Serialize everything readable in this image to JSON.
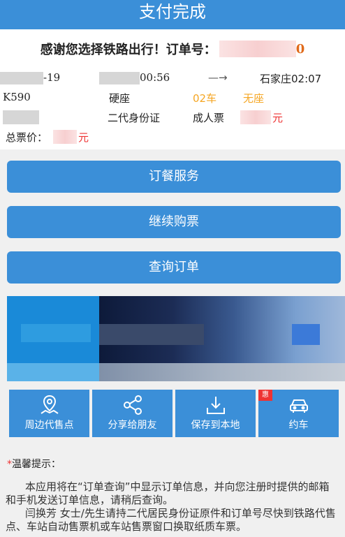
{
  "header": {
    "title": "支付完成"
  },
  "thanks": {
    "text": "感谢您选择铁路出行！订单号：",
    "order_tail": "0"
  },
  "ticket": {
    "date_suffix": "-19",
    "depart_time": "00:56",
    "arrow": "—→",
    "arrive": "石家庄02:07",
    "train_no": "K590",
    "seat_class": "硬座",
    "car": "02车",
    "seat": "无座",
    "id_type": "二代身份证",
    "ticket_type": "成人票",
    "price_unit": "元"
  },
  "total": {
    "label": "总票价：",
    "unit": "元"
  },
  "buttons": {
    "meal": "订餐服务",
    "continue": "继续购票",
    "query": "查询订单"
  },
  "tools": {
    "nearby": "周边代售点",
    "share": "分享给朋友",
    "save": "保存到本地",
    "car": "约车",
    "car_badge": "惠"
  },
  "tips": {
    "title": "温馨提示：",
    "line1": "本应用将在“订单查询”中显示订单信息，并向您注册时提供的邮箱和手机发送订单信息，请稍后查询。",
    "line2": "闫换芳 女士/先生请持二代居民身份证原件和订单号尽快到铁路代售点、车站自动售票机或车站售票窗口换取纸质车票。"
  },
  "colors": {
    "primary": "#3b8fd8",
    "accent": "#f5a623",
    "danger": "#e33333"
  }
}
